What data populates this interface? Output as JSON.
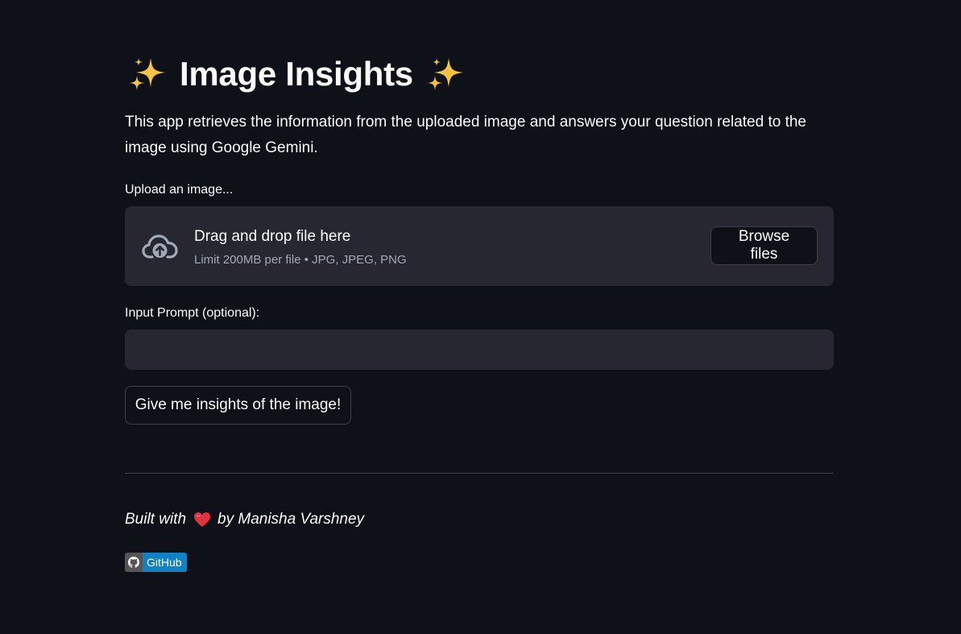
{
  "header": {
    "title": "Image Insights",
    "left_icon": "sparkles-icon",
    "right_icon": "sparkles-icon"
  },
  "description": "This app retrieves the information from the uploaded image and answers your question related to the image using Google Gemini.",
  "uploader": {
    "label": "Upload an image...",
    "drop_title": "Drag and drop file here",
    "limit_text": "Limit 200MB per file • JPG, JPEG, PNG",
    "browse_label": "Browse files",
    "icon": "cloud-upload-icon"
  },
  "prompt": {
    "label": "Input Prompt (optional):",
    "value": "",
    "placeholder": ""
  },
  "submit": {
    "label": "Give me insights of the image!"
  },
  "footer": {
    "built_with": "Built with",
    "by_text": "by Manisha Varshney",
    "heart_icon": "heart-icon",
    "badge_icon": "github-icon",
    "badge_label": "GitHub"
  },
  "colors": {
    "background": "#0e1117",
    "panel": "#262730",
    "text": "#fafafa",
    "muted": "#a3a8b8",
    "sparkle": "#f5c341",
    "heart": "#e0323f",
    "badge_left": "#555555",
    "badge_right": "#1081c2"
  }
}
